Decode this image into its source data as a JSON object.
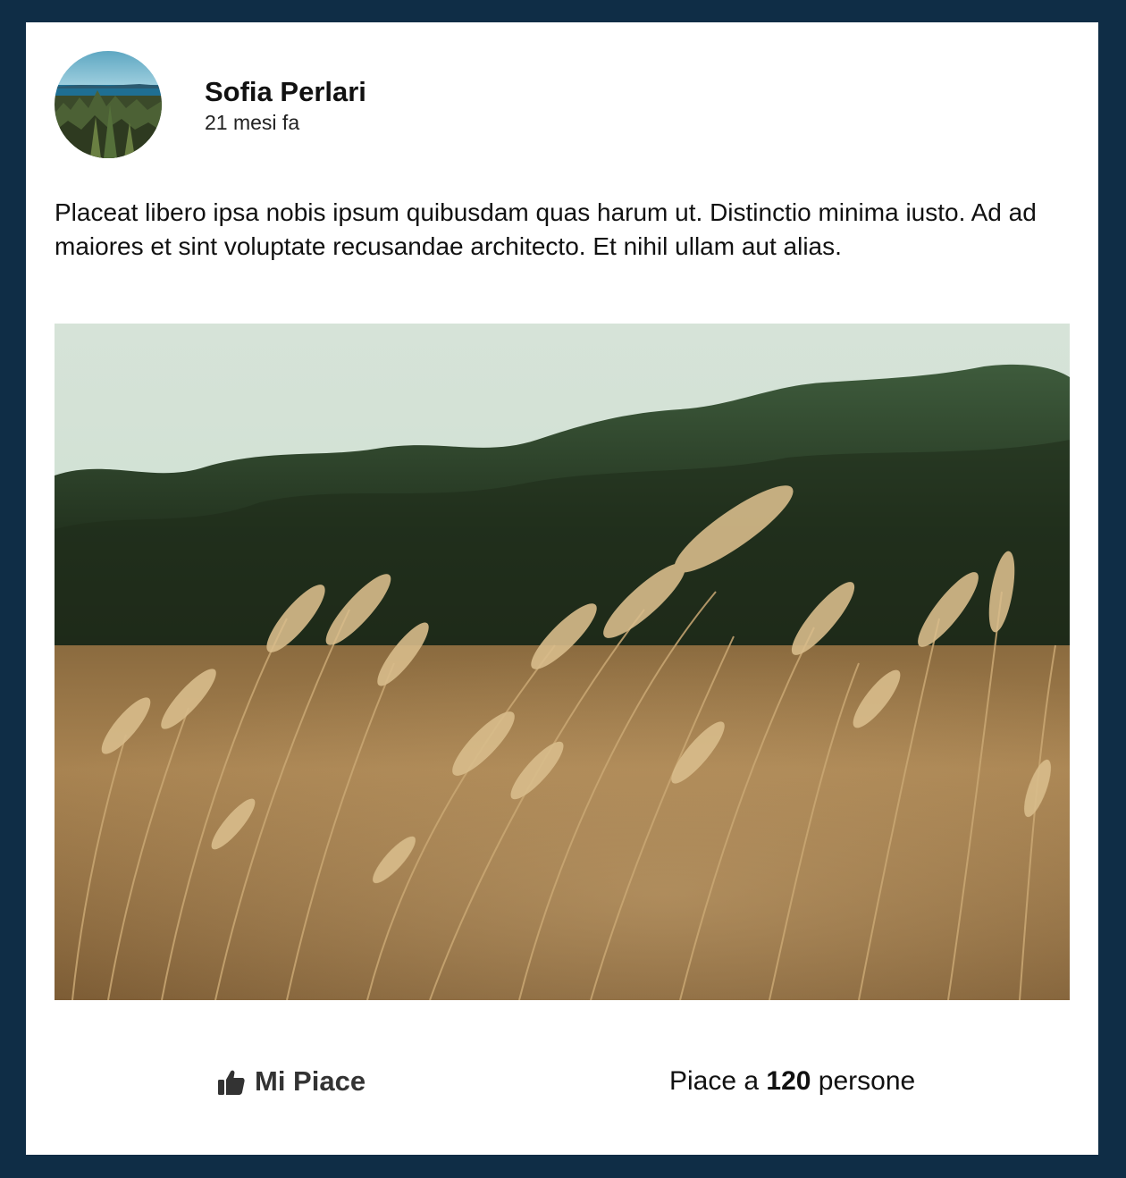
{
  "post": {
    "author": "Sofia Perlari",
    "time_ago": "21 mesi fa",
    "text": "Placeat libero ipsa nobis ipsum quibusdam quas harum ut. Distinctio minima iusto. Ad ad maiores et sint voluptate recusandae architecto. Et nihil ullam aut alias.",
    "image_alt": "wheat field"
  },
  "actions": {
    "like_label": "Mi Piace",
    "like_icon": "thumbs-up-icon",
    "likes_prefix": "Piace a ",
    "likes_count": "120",
    "likes_suffix": " persone"
  },
  "colors": {
    "page_background": "#0f2d46",
    "card_background": "#ffffff",
    "text": "#111111",
    "button_text": "#333333"
  }
}
